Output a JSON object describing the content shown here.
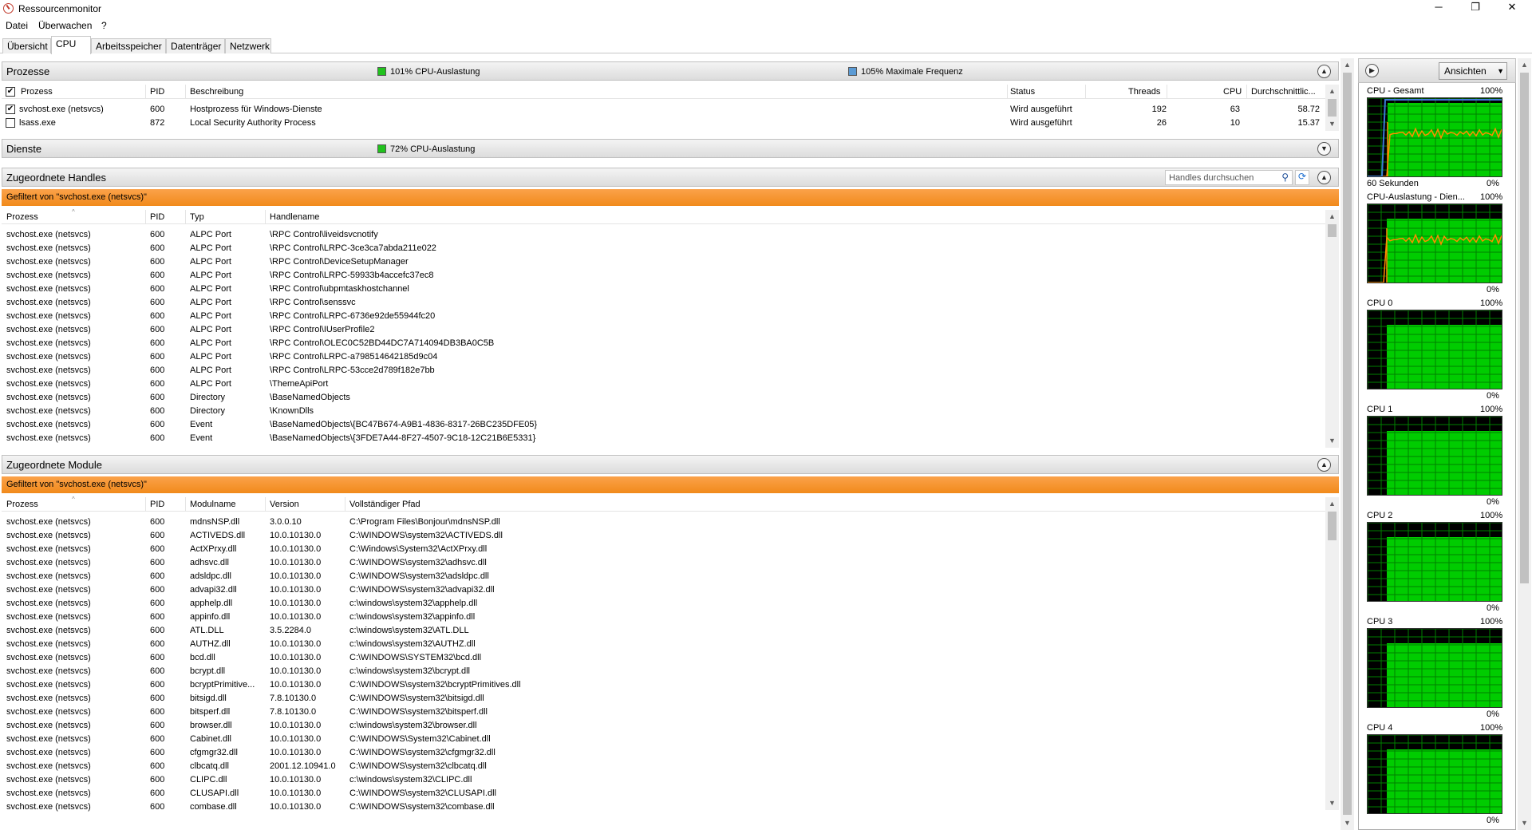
{
  "window": {
    "title": "Ressourcenmonitor",
    "minimize": "─",
    "restore": "❐",
    "close": "✕"
  },
  "menu": [
    "Datei",
    "Überwachen",
    "?"
  ],
  "tabs": [
    "Übersicht",
    "CPU",
    "Arbeitsspeicher",
    "Datenträger",
    "Netzwerk"
  ],
  "active_tab": "CPU",
  "processes": {
    "title": "Prozesse",
    "cpu_usage": "101% CPU-Auslastung",
    "max_freq": "105% Maximale Frequenz",
    "columns": [
      "Prozess",
      "PID",
      "Beschreibung",
      "Status",
      "Threads",
      "CPU",
      "Durchschnittlic..."
    ],
    "rows": [
      {
        "checked": true,
        "name": "svchost.exe (netsvcs)",
        "pid": "600",
        "desc": "Hostprozess für Windows-Dienste",
        "status": "Wird ausgeführt",
        "threads": "192",
        "cpu": "63",
        "avg": "58.72"
      },
      {
        "checked": false,
        "name": "lsass.exe",
        "pid": "872",
        "desc": "Local Security Authority Process",
        "status": "Wird ausgeführt",
        "threads": "26",
        "cpu": "10",
        "avg": "15.37"
      }
    ]
  },
  "services": {
    "title": "Dienste",
    "cpu_usage": "72% CPU-Auslastung"
  },
  "handles": {
    "title": "Zugeordnete Handles",
    "search_placeholder": "Handles durchsuchen",
    "filter": "Gefiltert von \"svchost.exe (netsvcs)\"",
    "columns": [
      "Prozess",
      "PID",
      "Typ",
      "Handlename"
    ],
    "rows": [
      [
        "svchost.exe (netsvcs)",
        "600",
        "ALPC Port",
        "\\RPC Control\\liveidsvcnotify"
      ],
      [
        "svchost.exe (netsvcs)",
        "600",
        "ALPC Port",
        "\\RPC Control\\LRPC-3ce3ca7abda211e022"
      ],
      [
        "svchost.exe (netsvcs)",
        "600",
        "ALPC Port",
        "\\RPC Control\\DeviceSetupManager"
      ],
      [
        "svchost.exe (netsvcs)",
        "600",
        "ALPC Port",
        "\\RPC Control\\LRPC-59933b4accefc37ec8"
      ],
      [
        "svchost.exe (netsvcs)",
        "600",
        "ALPC Port",
        "\\RPC Control\\ubpmtaskhostchannel"
      ],
      [
        "svchost.exe (netsvcs)",
        "600",
        "ALPC Port",
        "\\RPC Control\\senssvc"
      ],
      [
        "svchost.exe (netsvcs)",
        "600",
        "ALPC Port",
        "\\RPC Control\\LRPC-6736e92de55944fc20"
      ],
      [
        "svchost.exe (netsvcs)",
        "600",
        "ALPC Port",
        "\\RPC Control\\IUserProfile2"
      ],
      [
        "svchost.exe (netsvcs)",
        "600",
        "ALPC Port",
        "\\RPC Control\\OLEC0C52BD44DC7A714094DB3BA0C5B"
      ],
      [
        "svchost.exe (netsvcs)",
        "600",
        "ALPC Port",
        "\\RPC Control\\LRPC-a798514642185d9c04"
      ],
      [
        "svchost.exe (netsvcs)",
        "600",
        "ALPC Port",
        "\\RPC Control\\LRPC-53cce2d789f182e7bb"
      ],
      [
        "svchost.exe (netsvcs)",
        "600",
        "ALPC Port",
        "\\ThemeApiPort"
      ],
      [
        "svchost.exe (netsvcs)",
        "600",
        "Directory",
        "\\BaseNamedObjects"
      ],
      [
        "svchost.exe (netsvcs)",
        "600",
        "Directory",
        "\\KnownDlls"
      ],
      [
        "svchost.exe (netsvcs)",
        "600",
        "Event",
        "\\BaseNamedObjects\\{BC47B674-A9B1-4836-8317-26BC235DFE05}"
      ],
      [
        "svchost.exe (netsvcs)",
        "600",
        "Event",
        "\\BaseNamedObjects\\{3FDE7A44-8F27-4507-9C18-12C21B6E5331}"
      ]
    ]
  },
  "modules": {
    "title": "Zugeordnete Module",
    "filter": "Gefiltert von \"svchost.exe (netsvcs)\"",
    "columns": [
      "Prozess",
      "PID",
      "Modulname",
      "Version",
      "Vollständiger Pfad"
    ],
    "rows": [
      [
        "svchost.exe (netsvcs)",
        "600",
        "mdnsNSP.dll",
        "3.0.0.10",
        "C:\\Program Files\\Bonjour\\mdnsNSP.dll"
      ],
      [
        "svchost.exe (netsvcs)",
        "600",
        "ACTIVEDS.dll",
        "10.0.10130.0",
        "C:\\WINDOWS\\system32\\ACTIVEDS.dll"
      ],
      [
        "svchost.exe (netsvcs)",
        "600",
        "ActXPrxy.dll",
        "10.0.10130.0",
        "C:\\Windows\\System32\\ActXPrxy.dll"
      ],
      [
        "svchost.exe (netsvcs)",
        "600",
        "adhsvc.dll",
        "10.0.10130.0",
        "C:\\WINDOWS\\system32\\adhsvc.dll"
      ],
      [
        "svchost.exe (netsvcs)",
        "600",
        "adsldpc.dll",
        "10.0.10130.0",
        "C:\\WINDOWS\\system32\\adsldpc.dll"
      ],
      [
        "svchost.exe (netsvcs)",
        "600",
        "advapi32.dll",
        "10.0.10130.0",
        "C:\\WINDOWS\\system32\\advapi32.dll"
      ],
      [
        "svchost.exe (netsvcs)",
        "600",
        "apphelp.dll",
        "10.0.10130.0",
        "c:\\windows\\system32\\apphelp.dll"
      ],
      [
        "svchost.exe (netsvcs)",
        "600",
        "appinfo.dll",
        "10.0.10130.0",
        "c:\\windows\\system32\\appinfo.dll"
      ],
      [
        "svchost.exe (netsvcs)",
        "600",
        "ATL.DLL",
        "3.5.2284.0",
        "c:\\windows\\system32\\ATL.DLL"
      ],
      [
        "svchost.exe (netsvcs)",
        "600",
        "AUTHZ.dll",
        "10.0.10130.0",
        "c:\\windows\\system32\\AUTHZ.dll"
      ],
      [
        "svchost.exe (netsvcs)",
        "600",
        "bcd.dll",
        "10.0.10130.0",
        "C:\\WINDOWS\\SYSTEM32\\bcd.dll"
      ],
      [
        "svchost.exe (netsvcs)",
        "600",
        "bcrypt.dll",
        "10.0.10130.0",
        "c:\\windows\\system32\\bcrypt.dll"
      ],
      [
        "svchost.exe (netsvcs)",
        "600",
        "bcryptPrimitive...",
        "10.0.10130.0",
        "C:\\WINDOWS\\system32\\bcryptPrimitives.dll"
      ],
      [
        "svchost.exe (netsvcs)",
        "600",
        "bitsigd.dll",
        "7.8.10130.0",
        "C:\\WINDOWS\\system32\\bitsigd.dll"
      ],
      [
        "svchost.exe (netsvcs)",
        "600",
        "bitsperf.dll",
        "7.8.10130.0",
        "C:\\WINDOWS\\system32\\bitsperf.dll"
      ],
      [
        "svchost.exe (netsvcs)",
        "600",
        "browser.dll",
        "10.0.10130.0",
        "c:\\windows\\system32\\browser.dll"
      ],
      [
        "svchost.exe (netsvcs)",
        "600",
        "Cabinet.dll",
        "10.0.10130.0",
        "C:\\WINDOWS\\System32\\Cabinet.dll"
      ],
      [
        "svchost.exe (netsvcs)",
        "600",
        "cfgmgr32.dll",
        "10.0.10130.0",
        "C:\\WINDOWS\\system32\\cfgmgr32.dll"
      ],
      [
        "svchost.exe (netsvcs)",
        "600",
        "clbcatq.dll",
        "2001.12.10941.0",
        "C:\\WINDOWS\\system32\\clbcatq.dll"
      ],
      [
        "svchost.exe (netsvcs)",
        "600",
        "CLIPC.dll",
        "10.0.10130.0",
        "c:\\windows\\system32\\CLIPC.dll"
      ],
      [
        "svchost.exe (netsvcs)",
        "600",
        "CLUSAPI.dll",
        "10.0.10130.0",
        "C:\\WINDOWS\\system32\\CLUSAPI.dll"
      ],
      [
        "svchost.exe (netsvcs)",
        "600",
        "combase.dll",
        "10.0.10130.0",
        "C:\\WINDOWS\\system32\\combase.dll"
      ]
    ]
  },
  "graphs": {
    "views_button": "Ansichten",
    "items": [
      {
        "label": "CPU - Gesamt",
        "max": "100%",
        "min": "0%",
        "footer": "60 Sekunden"
      },
      {
        "label": "CPU-Auslastung - Dien...",
        "max": "100%",
        "min": "0%"
      },
      {
        "label": "CPU 0",
        "max": "100%",
        "min": "0%"
      },
      {
        "label": "CPU 1",
        "max": "100%",
        "min": "0%"
      },
      {
        "label": "CPU 2",
        "max": "100%",
        "min": "0%"
      },
      {
        "label": "CPU 3",
        "max": "100%",
        "min": "0%"
      },
      {
        "label": "CPU 4",
        "max": "100%",
        "min": "0%"
      }
    ],
    "colors": {
      "grid": "#008000",
      "fill": "#00cc00",
      "line_orange": "#ff8c00",
      "line_blue": "#3b7bd6",
      "bg": "#000000"
    }
  }
}
